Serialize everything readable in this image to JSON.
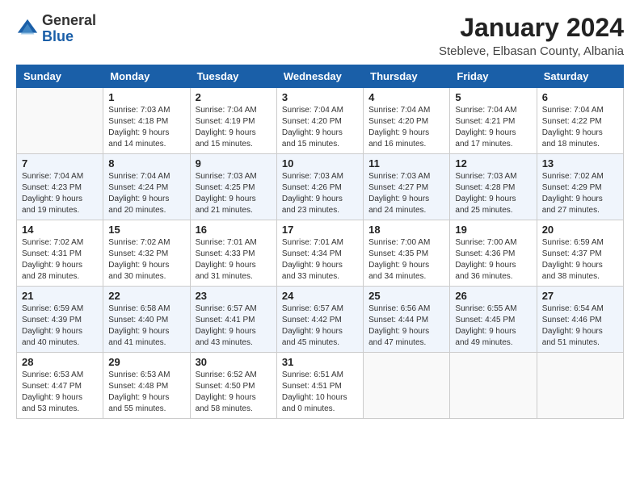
{
  "header": {
    "logo_general": "General",
    "logo_blue": "Blue",
    "month": "January 2024",
    "location": "Stebleve, Elbasan County, Albania"
  },
  "days_of_week": [
    "Sunday",
    "Monday",
    "Tuesday",
    "Wednesday",
    "Thursday",
    "Friday",
    "Saturday"
  ],
  "weeks": [
    [
      {
        "day": "",
        "sunrise": "",
        "sunset": "",
        "daylight": ""
      },
      {
        "day": "1",
        "sunrise": "Sunrise: 7:03 AM",
        "sunset": "Sunset: 4:18 PM",
        "daylight": "Daylight: 9 hours and 14 minutes."
      },
      {
        "day": "2",
        "sunrise": "Sunrise: 7:04 AM",
        "sunset": "Sunset: 4:19 PM",
        "daylight": "Daylight: 9 hours and 15 minutes."
      },
      {
        "day": "3",
        "sunrise": "Sunrise: 7:04 AM",
        "sunset": "Sunset: 4:20 PM",
        "daylight": "Daylight: 9 hours and 15 minutes."
      },
      {
        "day": "4",
        "sunrise": "Sunrise: 7:04 AM",
        "sunset": "Sunset: 4:20 PM",
        "daylight": "Daylight: 9 hours and 16 minutes."
      },
      {
        "day": "5",
        "sunrise": "Sunrise: 7:04 AM",
        "sunset": "Sunset: 4:21 PM",
        "daylight": "Daylight: 9 hours and 17 minutes."
      },
      {
        "day": "6",
        "sunrise": "Sunrise: 7:04 AM",
        "sunset": "Sunset: 4:22 PM",
        "daylight": "Daylight: 9 hours and 18 minutes."
      }
    ],
    [
      {
        "day": "7",
        "sunrise": "Sunrise: 7:04 AM",
        "sunset": "Sunset: 4:23 PM",
        "daylight": "Daylight: 9 hours and 19 minutes."
      },
      {
        "day": "8",
        "sunrise": "Sunrise: 7:04 AM",
        "sunset": "Sunset: 4:24 PM",
        "daylight": "Daylight: 9 hours and 20 minutes."
      },
      {
        "day": "9",
        "sunrise": "Sunrise: 7:03 AM",
        "sunset": "Sunset: 4:25 PM",
        "daylight": "Daylight: 9 hours and 21 minutes."
      },
      {
        "day": "10",
        "sunrise": "Sunrise: 7:03 AM",
        "sunset": "Sunset: 4:26 PM",
        "daylight": "Daylight: 9 hours and 23 minutes."
      },
      {
        "day": "11",
        "sunrise": "Sunrise: 7:03 AM",
        "sunset": "Sunset: 4:27 PM",
        "daylight": "Daylight: 9 hours and 24 minutes."
      },
      {
        "day": "12",
        "sunrise": "Sunrise: 7:03 AM",
        "sunset": "Sunset: 4:28 PM",
        "daylight": "Daylight: 9 hours and 25 minutes."
      },
      {
        "day": "13",
        "sunrise": "Sunrise: 7:02 AM",
        "sunset": "Sunset: 4:29 PM",
        "daylight": "Daylight: 9 hours and 27 minutes."
      }
    ],
    [
      {
        "day": "14",
        "sunrise": "Sunrise: 7:02 AM",
        "sunset": "Sunset: 4:31 PM",
        "daylight": "Daylight: 9 hours and 28 minutes."
      },
      {
        "day": "15",
        "sunrise": "Sunrise: 7:02 AM",
        "sunset": "Sunset: 4:32 PM",
        "daylight": "Daylight: 9 hours and 30 minutes."
      },
      {
        "day": "16",
        "sunrise": "Sunrise: 7:01 AM",
        "sunset": "Sunset: 4:33 PM",
        "daylight": "Daylight: 9 hours and 31 minutes."
      },
      {
        "day": "17",
        "sunrise": "Sunrise: 7:01 AM",
        "sunset": "Sunset: 4:34 PM",
        "daylight": "Daylight: 9 hours and 33 minutes."
      },
      {
        "day": "18",
        "sunrise": "Sunrise: 7:00 AM",
        "sunset": "Sunset: 4:35 PM",
        "daylight": "Daylight: 9 hours and 34 minutes."
      },
      {
        "day": "19",
        "sunrise": "Sunrise: 7:00 AM",
        "sunset": "Sunset: 4:36 PM",
        "daylight": "Daylight: 9 hours and 36 minutes."
      },
      {
        "day": "20",
        "sunrise": "Sunrise: 6:59 AM",
        "sunset": "Sunset: 4:37 PM",
        "daylight": "Daylight: 9 hours and 38 minutes."
      }
    ],
    [
      {
        "day": "21",
        "sunrise": "Sunrise: 6:59 AM",
        "sunset": "Sunset: 4:39 PM",
        "daylight": "Daylight: 9 hours and 40 minutes."
      },
      {
        "day": "22",
        "sunrise": "Sunrise: 6:58 AM",
        "sunset": "Sunset: 4:40 PM",
        "daylight": "Daylight: 9 hours and 41 minutes."
      },
      {
        "day": "23",
        "sunrise": "Sunrise: 6:57 AM",
        "sunset": "Sunset: 4:41 PM",
        "daylight": "Daylight: 9 hours and 43 minutes."
      },
      {
        "day": "24",
        "sunrise": "Sunrise: 6:57 AM",
        "sunset": "Sunset: 4:42 PM",
        "daylight": "Daylight: 9 hours and 45 minutes."
      },
      {
        "day": "25",
        "sunrise": "Sunrise: 6:56 AM",
        "sunset": "Sunset: 4:44 PM",
        "daylight": "Daylight: 9 hours and 47 minutes."
      },
      {
        "day": "26",
        "sunrise": "Sunrise: 6:55 AM",
        "sunset": "Sunset: 4:45 PM",
        "daylight": "Daylight: 9 hours and 49 minutes."
      },
      {
        "day": "27",
        "sunrise": "Sunrise: 6:54 AM",
        "sunset": "Sunset: 4:46 PM",
        "daylight": "Daylight: 9 hours and 51 minutes."
      }
    ],
    [
      {
        "day": "28",
        "sunrise": "Sunrise: 6:53 AM",
        "sunset": "Sunset: 4:47 PM",
        "daylight": "Daylight: 9 hours and 53 minutes."
      },
      {
        "day": "29",
        "sunrise": "Sunrise: 6:53 AM",
        "sunset": "Sunset: 4:48 PM",
        "daylight": "Daylight: 9 hours and 55 minutes."
      },
      {
        "day": "30",
        "sunrise": "Sunrise: 6:52 AM",
        "sunset": "Sunset: 4:50 PM",
        "daylight": "Daylight: 9 hours and 58 minutes."
      },
      {
        "day": "31",
        "sunrise": "Sunrise: 6:51 AM",
        "sunset": "Sunset: 4:51 PM",
        "daylight": "Daylight: 10 hours and 0 minutes."
      },
      {
        "day": "",
        "sunrise": "",
        "sunset": "",
        "daylight": ""
      },
      {
        "day": "",
        "sunrise": "",
        "sunset": "",
        "daylight": ""
      },
      {
        "day": "",
        "sunrise": "",
        "sunset": "",
        "daylight": ""
      }
    ]
  ]
}
